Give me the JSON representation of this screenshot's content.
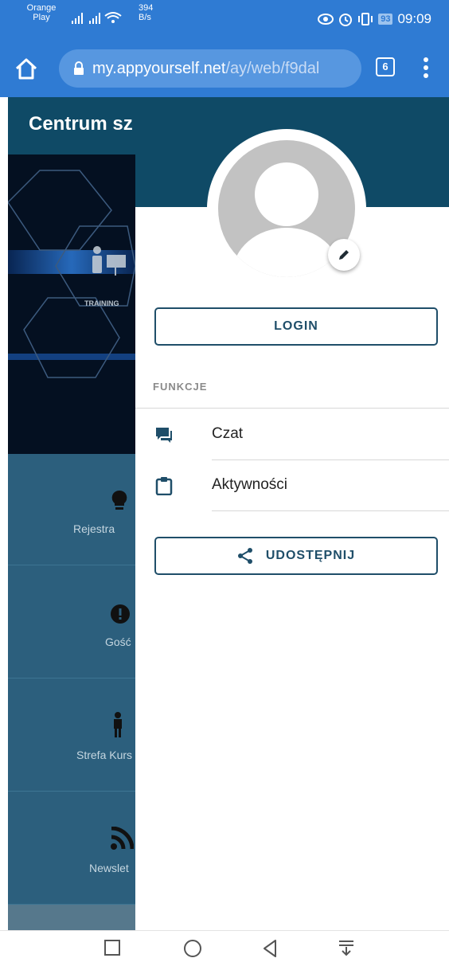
{
  "status_bar": {
    "carrier_line1": "Orange",
    "carrier_line2": "Play",
    "net_speed_value": "394",
    "net_speed_unit": "B/s",
    "battery": "93",
    "time": "09:09"
  },
  "browser": {
    "url_domain": "my.appyourself.net",
    "url_path": "/ay/web/f9dal",
    "tab_count": "6"
  },
  "app": {
    "title": "Centrum sz",
    "hero_caption": "TRAINING",
    "grid_items": [
      {
        "label": "Rejestra",
        "icon": "lightbulb-icon"
      },
      {
        "label": "Gość",
        "icon": "exclamation-circle-icon"
      },
      {
        "label": "Strefa Kurs",
        "icon": "person-icon"
      },
      {
        "label": "Newslet",
        "icon": "rss-icon"
      }
    ]
  },
  "drawer": {
    "login_label": "LOGIN",
    "section_label": "FUNKCJE",
    "menu_items": [
      {
        "label": "Czat",
        "icon": "chat-icon"
      },
      {
        "label": "Aktywności",
        "icon": "clipboard-icon"
      }
    ],
    "share_label": "UDOSTĘPNIJ"
  },
  "colors": {
    "browser_blue": "#2f7bd3",
    "header_dark": "#0f4a66",
    "app_bg": "#2c5f7d",
    "accent": "#1f4e69"
  }
}
